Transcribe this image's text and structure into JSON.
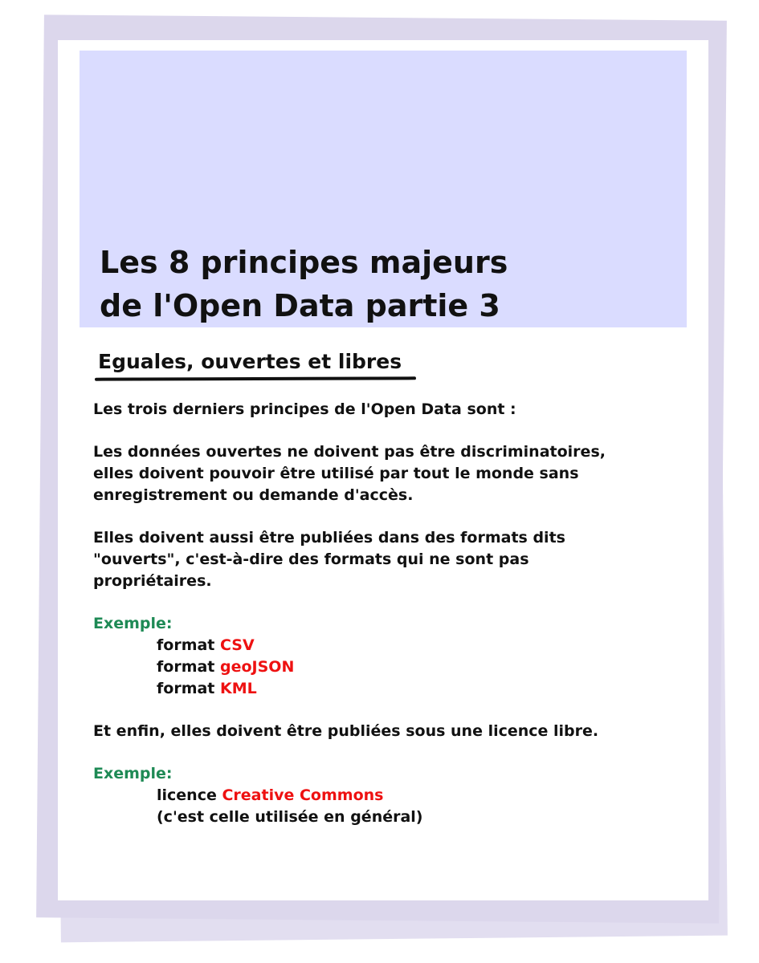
{
  "title": {
    "line1": "Les 8 principes majeurs",
    "line2": "de l'Open Data partie 3"
  },
  "section_heading": "Eguales, ouvertes et libres",
  "intro": "Les trois derniers principes de l'Open Data sont :",
  "paragraph1": {
    "line1": "Les données ouvertes ne doivent pas être discriminatoires,",
    "line2": "elles doivent pouvoir être utilisé par tout le monde sans",
    "line3": "enregistrement ou demande d'accès."
  },
  "paragraph2": {
    "line1": "Elles doivent aussi être publiées dans des formats dits",
    "line2": "\"ouverts\", c'est-à-dire des formats qui ne sont pas",
    "line3": "propriétaires."
  },
  "example1": {
    "label": "Exemple:",
    "items": [
      {
        "prefix": "format ",
        "highlight": "CSV"
      },
      {
        "prefix": "format ",
        "highlight": "geoJSON"
      },
      {
        "prefix": "format ",
        "highlight": "KML"
      }
    ]
  },
  "paragraph3": "Et enfin, elles doivent être publiées sous une licence libre.",
  "example2": {
    "label": "Exemple:",
    "prefix": "licence ",
    "highlight": "Creative Commons",
    "note": "(c'est celle utilisée en général)"
  },
  "colors": {
    "header_band": "#dadcff",
    "example_label": "#1e8a55",
    "highlight": "#ee1111",
    "sheet_shadow": "#dcd7ec"
  }
}
